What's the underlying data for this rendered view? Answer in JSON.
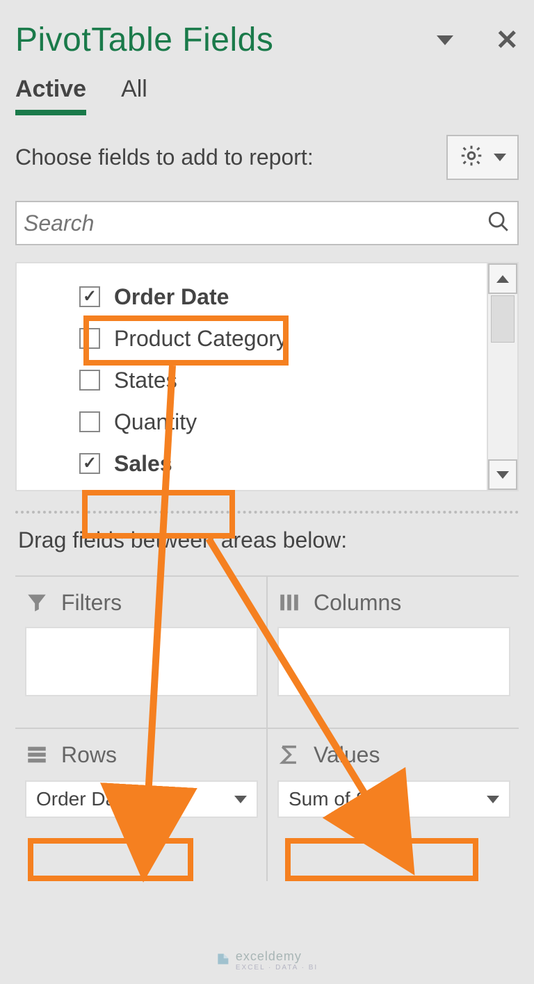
{
  "header": {
    "title": "PivotTable Fields"
  },
  "tabs": {
    "active": "Active",
    "all": "All"
  },
  "instruction": "Choose fields to add to report:",
  "search": {
    "placeholder": "Search"
  },
  "fields": [
    {
      "label": "Order Date",
      "checked": true
    },
    {
      "label": "Product Category",
      "checked": false
    },
    {
      "label": "States",
      "checked": false
    },
    {
      "label": "Quantity",
      "checked": false
    },
    {
      "label": "Sales",
      "checked": true
    }
  ],
  "dragLabel": "Drag fields between areas below:",
  "areas": {
    "filters": {
      "label": "Filters"
    },
    "columns": {
      "label": "Columns"
    },
    "rows": {
      "label": "Rows",
      "item": "Order Date"
    },
    "values": {
      "label": "Values",
      "item": "Sum of Sales"
    }
  },
  "watermark": {
    "brand": "exceldemy",
    "sub": "EXCEL · DATA · BI"
  }
}
